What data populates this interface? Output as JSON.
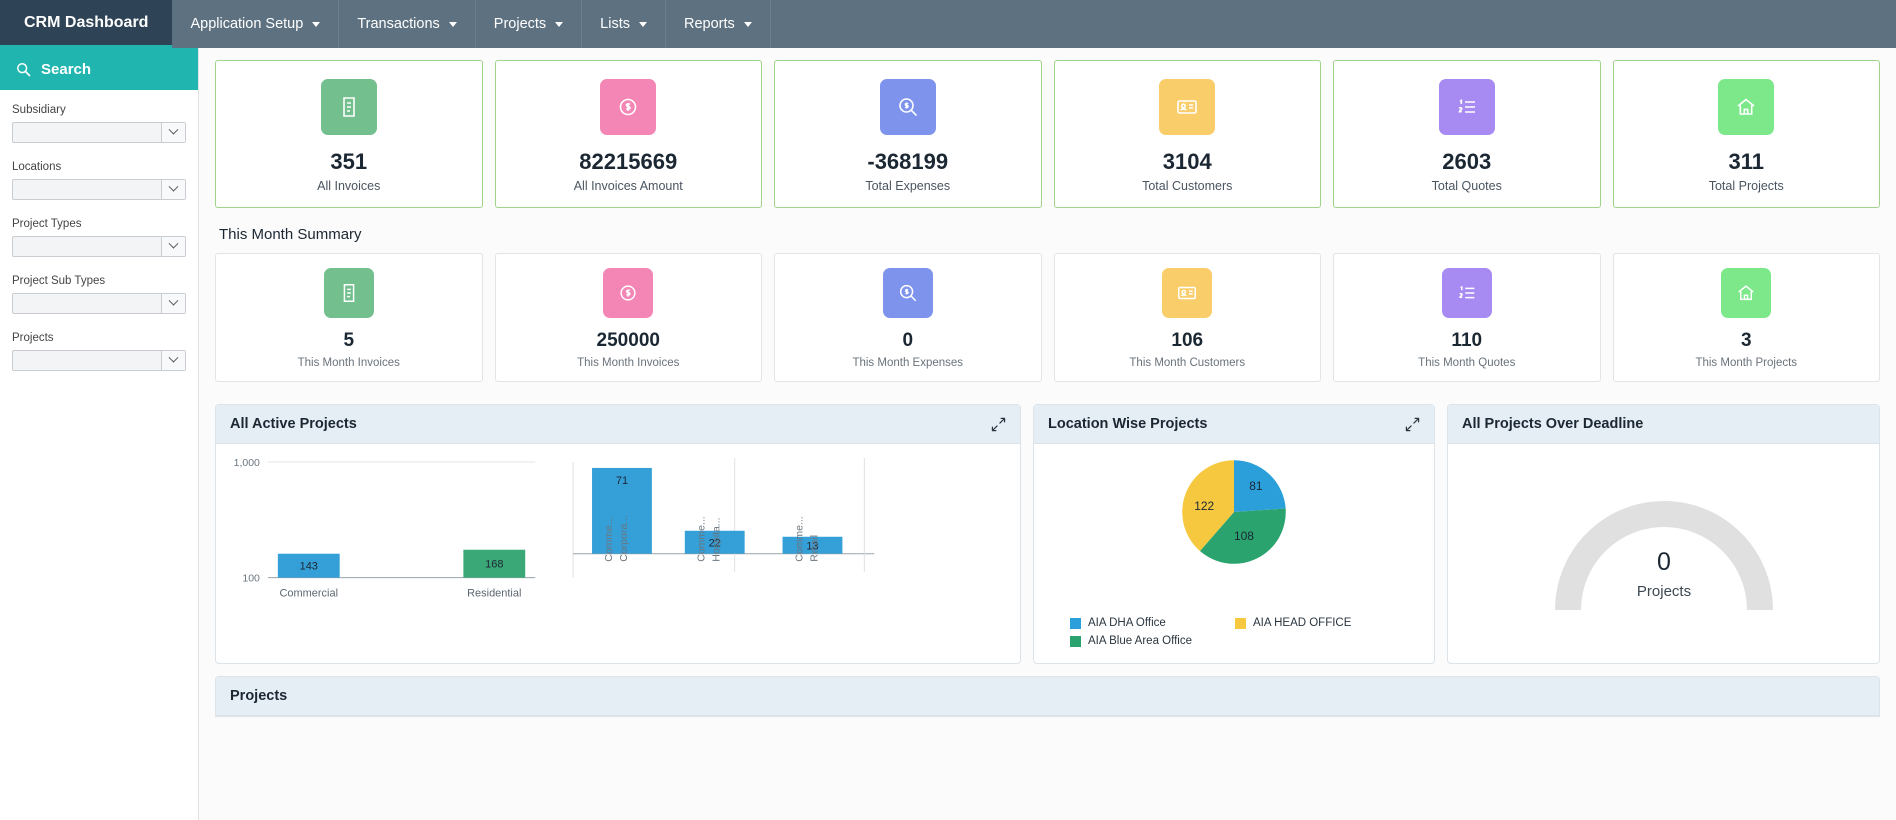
{
  "navbar": {
    "brand": "CRM Dashboard",
    "items": [
      {
        "label": "Application Setup",
        "has_caret": true
      },
      {
        "label": "Transactions",
        "has_caret": true
      },
      {
        "label": "Projects",
        "has_caret": true
      },
      {
        "label": "Lists",
        "has_caret": true
      },
      {
        "label": "Reports",
        "has_caret": true
      }
    ]
  },
  "sidebar": {
    "search_label": "Search",
    "filters": [
      {
        "label": "Subsidiary",
        "value": ""
      },
      {
        "label": "Locations",
        "value": ""
      },
      {
        "label": "Project Types",
        "value": ""
      },
      {
        "label": "Project Sub Types",
        "value": ""
      },
      {
        "label": "Projects",
        "value": ""
      }
    ]
  },
  "kpis": [
    {
      "value": "351",
      "label": "All Invoices",
      "color": "#73bf8e",
      "icon": "invoice-icon"
    },
    {
      "value": "82215669",
      "label": "All Invoices Amount",
      "color": "#f486b5",
      "icon": "dollar-badge-icon"
    },
    {
      "value": "-368199",
      "label": "Total Expenses",
      "color": "#7e93ec",
      "icon": "search-dollar-icon"
    },
    {
      "value": "3104",
      "label": "Total Customers",
      "color": "#f9cd6a",
      "icon": "id-card-icon"
    },
    {
      "value": "2603",
      "label": "Total Quotes",
      "color": "#a88bf2",
      "icon": "list-ol-icon"
    },
    {
      "value": "311",
      "label": "Total Projects",
      "color": "#7ce88a",
      "icon": "home-icon"
    }
  ],
  "month_summary": {
    "title": "This Month Summary",
    "kpis": [
      {
        "value": "5",
        "label": "This Month Invoices",
        "color": "#73bf8e",
        "icon": "invoice-icon"
      },
      {
        "value": "250000",
        "label": "This Month Invoices",
        "color": "#f486b5",
        "icon": "dollar-badge-icon"
      },
      {
        "value": "0",
        "label": "This Month Expenses",
        "color": "#7e93ec",
        "icon": "search-dollar-icon"
      },
      {
        "value": "106",
        "label": "This Month Customers",
        "color": "#f9cd6a",
        "icon": "id-card-icon"
      },
      {
        "value": "110",
        "label": "This Month Quotes",
        "color": "#a88bf2",
        "icon": "list-ol-icon"
      },
      {
        "value": "3",
        "label": "This Month Projects",
        "color": "#7ce88a",
        "icon": "home-icon"
      }
    ]
  },
  "panels": {
    "active_projects": {
      "title": "All Active Projects"
    },
    "location_projects": {
      "title": "Location Wise Projects"
    },
    "over_deadline": {
      "title": "All Projects Over Deadline"
    },
    "projects_table": {
      "title": "Projects"
    }
  },
  "gauge": {
    "value": "0",
    "label": "Projects",
    "track_color": "#e0e0e0"
  },
  "chart_data": [
    {
      "type": "bar",
      "title": "All Active Projects",
      "categories": [
        "Commercial",
        "Residential",
        "Comme... Corpora...",
        "Comme... Hospita...",
        "Comme... Retail"
      ],
      "values": [
        143,
        168,
        71,
        22,
        13
      ],
      "colors": [
        "#359fd8",
        "#3aa877",
        "#359fd8",
        "#359fd8",
        "#359fd8"
      ],
      "ytick_labels": [
        "1,000",
        "100"
      ],
      "ylim": [
        100,
        1000
      ],
      "xlabel": "",
      "ylabel": "",
      "grid": true,
      "legend": "none"
    },
    {
      "type": "pie",
      "title": "Location Wise Projects",
      "labels": [
        "AIA DHA Office",
        "AIA Blue Area Office",
        "AIA HEAD OFFICE"
      ],
      "values": [
        81,
        108,
        122
      ],
      "colors": [
        "#2b9fd9",
        "#2ba36f",
        "#f6c githa"
      ],
      "legend": "bottom"
    },
    {
      "type": "gauge",
      "title": "All Projects Over Deadline",
      "value": 0,
      "label": "Projects",
      "min": 0,
      "max": 100
    }
  ]
}
